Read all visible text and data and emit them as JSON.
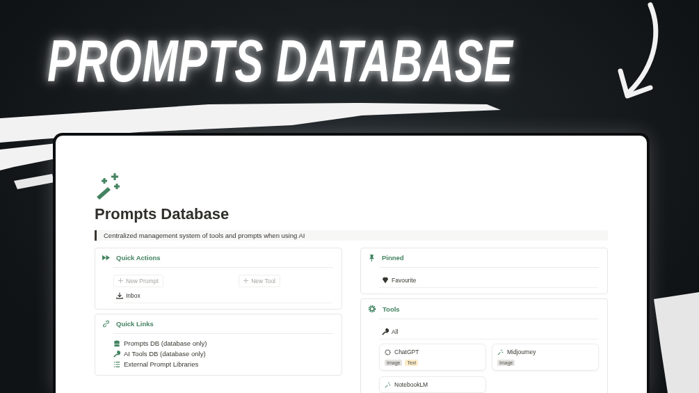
{
  "headline": "PROMPTS DATABASE",
  "page": {
    "title": "Prompts Database",
    "description": "Centralized management system of tools and prompts when using AI",
    "quick_actions": {
      "title": "Quick Actions",
      "buttons": [
        "New Prompt",
        "New Tool"
      ],
      "links": [
        "Inbox"
      ]
    },
    "quick_links": {
      "title": "Quick Links",
      "items": [
        {
          "label": "Prompts DB (database only)",
          "kind": "database"
        },
        {
          "label": "AI Tools DB (database only)",
          "kind": "wrench"
        },
        {
          "label": "External Prompt Libraries",
          "kind": "list"
        }
      ]
    },
    "pinned": {
      "title": "Pinned",
      "items": [
        "Favourite"
      ]
    },
    "tools": {
      "title": "Tools",
      "views": [
        "All"
      ],
      "cards": [
        {
          "name": "ChatGPT",
          "kind": "gear",
          "tags": [
            {
              "label": "Image",
              "color": "#e3e2e0"
            },
            {
              "label": "Text",
              "color": "#fdecc8"
            }
          ]
        },
        {
          "name": "Midjourney",
          "kind": "wand",
          "tags": [
            {
              "label": "Image",
              "color": "#e3e2e0"
            }
          ]
        },
        {
          "name": "NotebookLM",
          "kind": "wand"
        }
      ]
    }
  }
}
